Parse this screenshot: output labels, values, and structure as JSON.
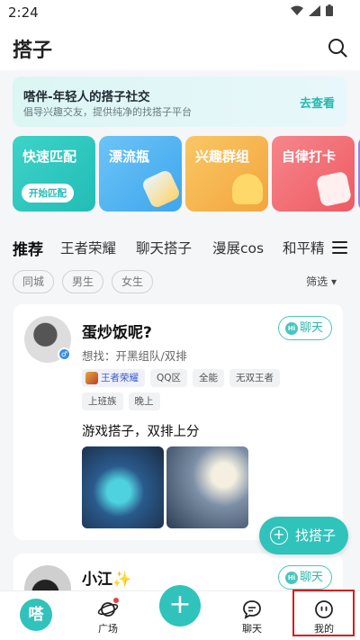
{
  "status": {
    "time": "2:24"
  },
  "header": {
    "title": "搭子"
  },
  "banner": {
    "title": "嗒伴-年轻人的搭子社交",
    "subtitle": "倡导兴趣交友，提供纯净的找搭子平台",
    "action": "去查看"
  },
  "cards": [
    {
      "label": "快速匹配",
      "button": "开始匹配",
      "color": "#2cc7c0"
    },
    {
      "label": "漂流瓶",
      "color": "#4fb3f0"
    },
    {
      "label": "兴趣群组",
      "color": "#f5b34b"
    },
    {
      "label": "自律打卡",
      "color": "#f16a72"
    }
  ],
  "tabs": [
    "推荐",
    "王者荣耀",
    "聊天搭子",
    "漫展cos",
    "和平精"
  ],
  "filters": {
    "chips": [
      "同城",
      "男生",
      "女生"
    ],
    "sort": "筛选 ▾"
  },
  "posts": [
    {
      "name": "蛋炒饭呢?",
      "seek": "想找：开黑组队/双排",
      "chat": "聊天",
      "tags_row1": [
        "王者荣耀",
        "QQ区",
        "全能",
        "无双王者"
      ],
      "tags_row2": [
        "上班族",
        "晚上"
      ],
      "text": "游戏搭子，双排上分"
    },
    {
      "name": "小江✨",
      "chat": "聊天"
    }
  ],
  "fab": {
    "label": "找搭子"
  },
  "nav": {
    "home": "嗒",
    "square": "广场",
    "chat": "聊天",
    "me": "我的"
  }
}
